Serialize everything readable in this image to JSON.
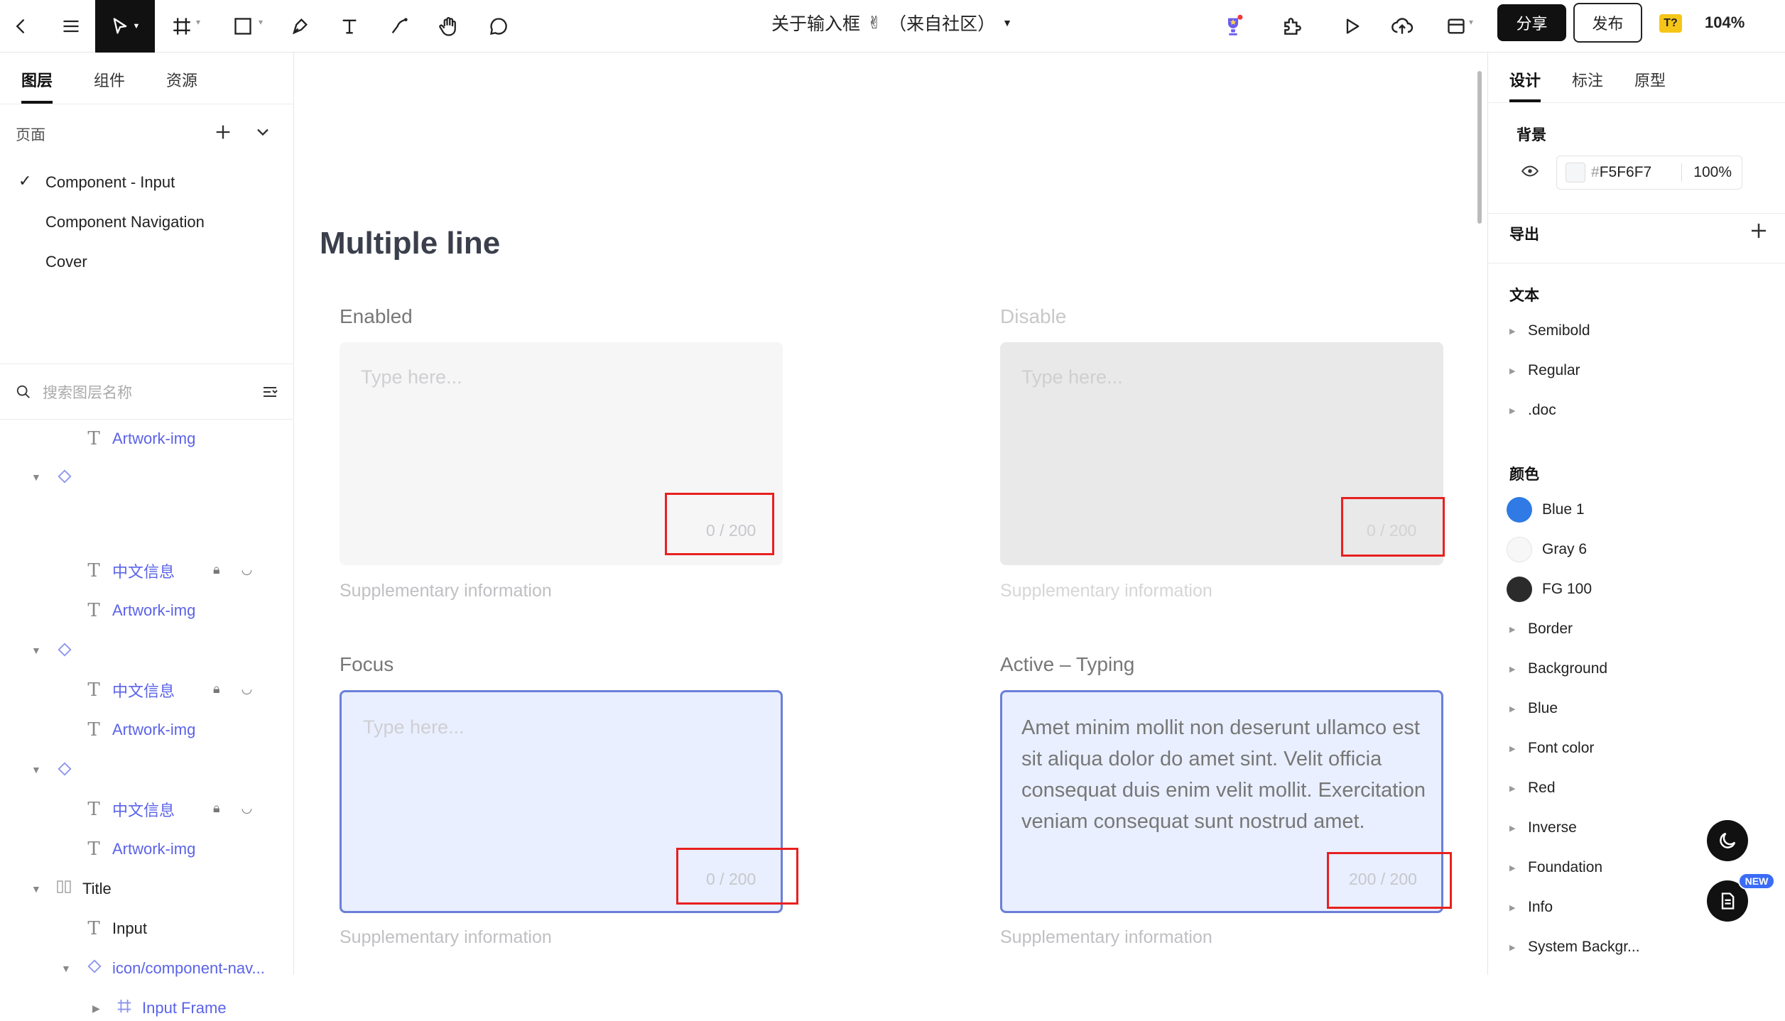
{
  "toolbar": {
    "doc_title": "关于输入框",
    "doc_suffix": "（来自社区）",
    "share_label": "分享",
    "publish_label": "发布",
    "ai_badge": "T?",
    "zoom": "104%"
  },
  "left_panel": {
    "tabs": [
      "图层",
      "组件",
      "资源"
    ],
    "pages_label": "页面",
    "pages": [
      {
        "label": "Component - Input",
        "selected": true
      },
      {
        "label": "Component Navigation",
        "selected": false
      },
      {
        "label": "Cover",
        "selected": false
      }
    ],
    "search_placeholder": "搜索图层名称",
    "layers": {
      "l1": "Artwork-img",
      "l2": "中文信息",
      "l3": "Artwork-img",
      "l4": "中文信息",
      "l5": "Artwork-img",
      "l6": "中文信息",
      "l7": "Artwork-img",
      "l8": "Title",
      "l9": "Input",
      "l10": "icon/component-nav...",
      "l11": "Input Frame"
    }
  },
  "canvas": {
    "section_title": "Multiple line",
    "enabled": {
      "label": "Enabled",
      "placeholder": "Type here...",
      "counter": "0 / 200",
      "supp": "Supplementary information"
    },
    "disable": {
      "label": "Disable",
      "placeholder": "Type here...",
      "counter": "0 / 200",
      "supp": "Supplementary information"
    },
    "focus": {
      "label": "Focus",
      "placeholder": "Type here...",
      "counter": "0 / 200",
      "supp": "Supplementary information"
    },
    "active": {
      "label": "Active – Typing",
      "text": "Amet minim mollit non deserunt ullamco est sit aliqua dolor do amet sint. Velit officia consequat duis enim velit mollit. Exercitation veniam consequat sunt nostrud amet.",
      "counter": "200 / 200",
      "supp": "Supplementary information"
    }
  },
  "right_panel": {
    "tabs": [
      "设计",
      "标注",
      "原型"
    ],
    "background_label": "背景",
    "bg_hex_prefix": "#",
    "bg_hex": "F5F6F7",
    "bg_opacity": "100",
    "bg_opacity_unit": "%",
    "export_label": "导出",
    "text_label": "文本",
    "text_styles": [
      "Semibold",
      "Regular",
      ".doc"
    ],
    "color_label": "颜色",
    "colors": [
      {
        "name": "Blue 1",
        "hex": "#2f7ae5"
      },
      {
        "name": "Gray 6",
        "hex": "#f7f7f7"
      },
      {
        "name": "FG 100",
        "hex": "#2b2b2b"
      }
    ],
    "color_groups": [
      "Border",
      "Background",
      "Blue",
      "Font color",
      "Red",
      "Inverse",
      "Foundation",
      "Info",
      "System Backgr..."
    ],
    "new_badge": "NEW"
  }
}
